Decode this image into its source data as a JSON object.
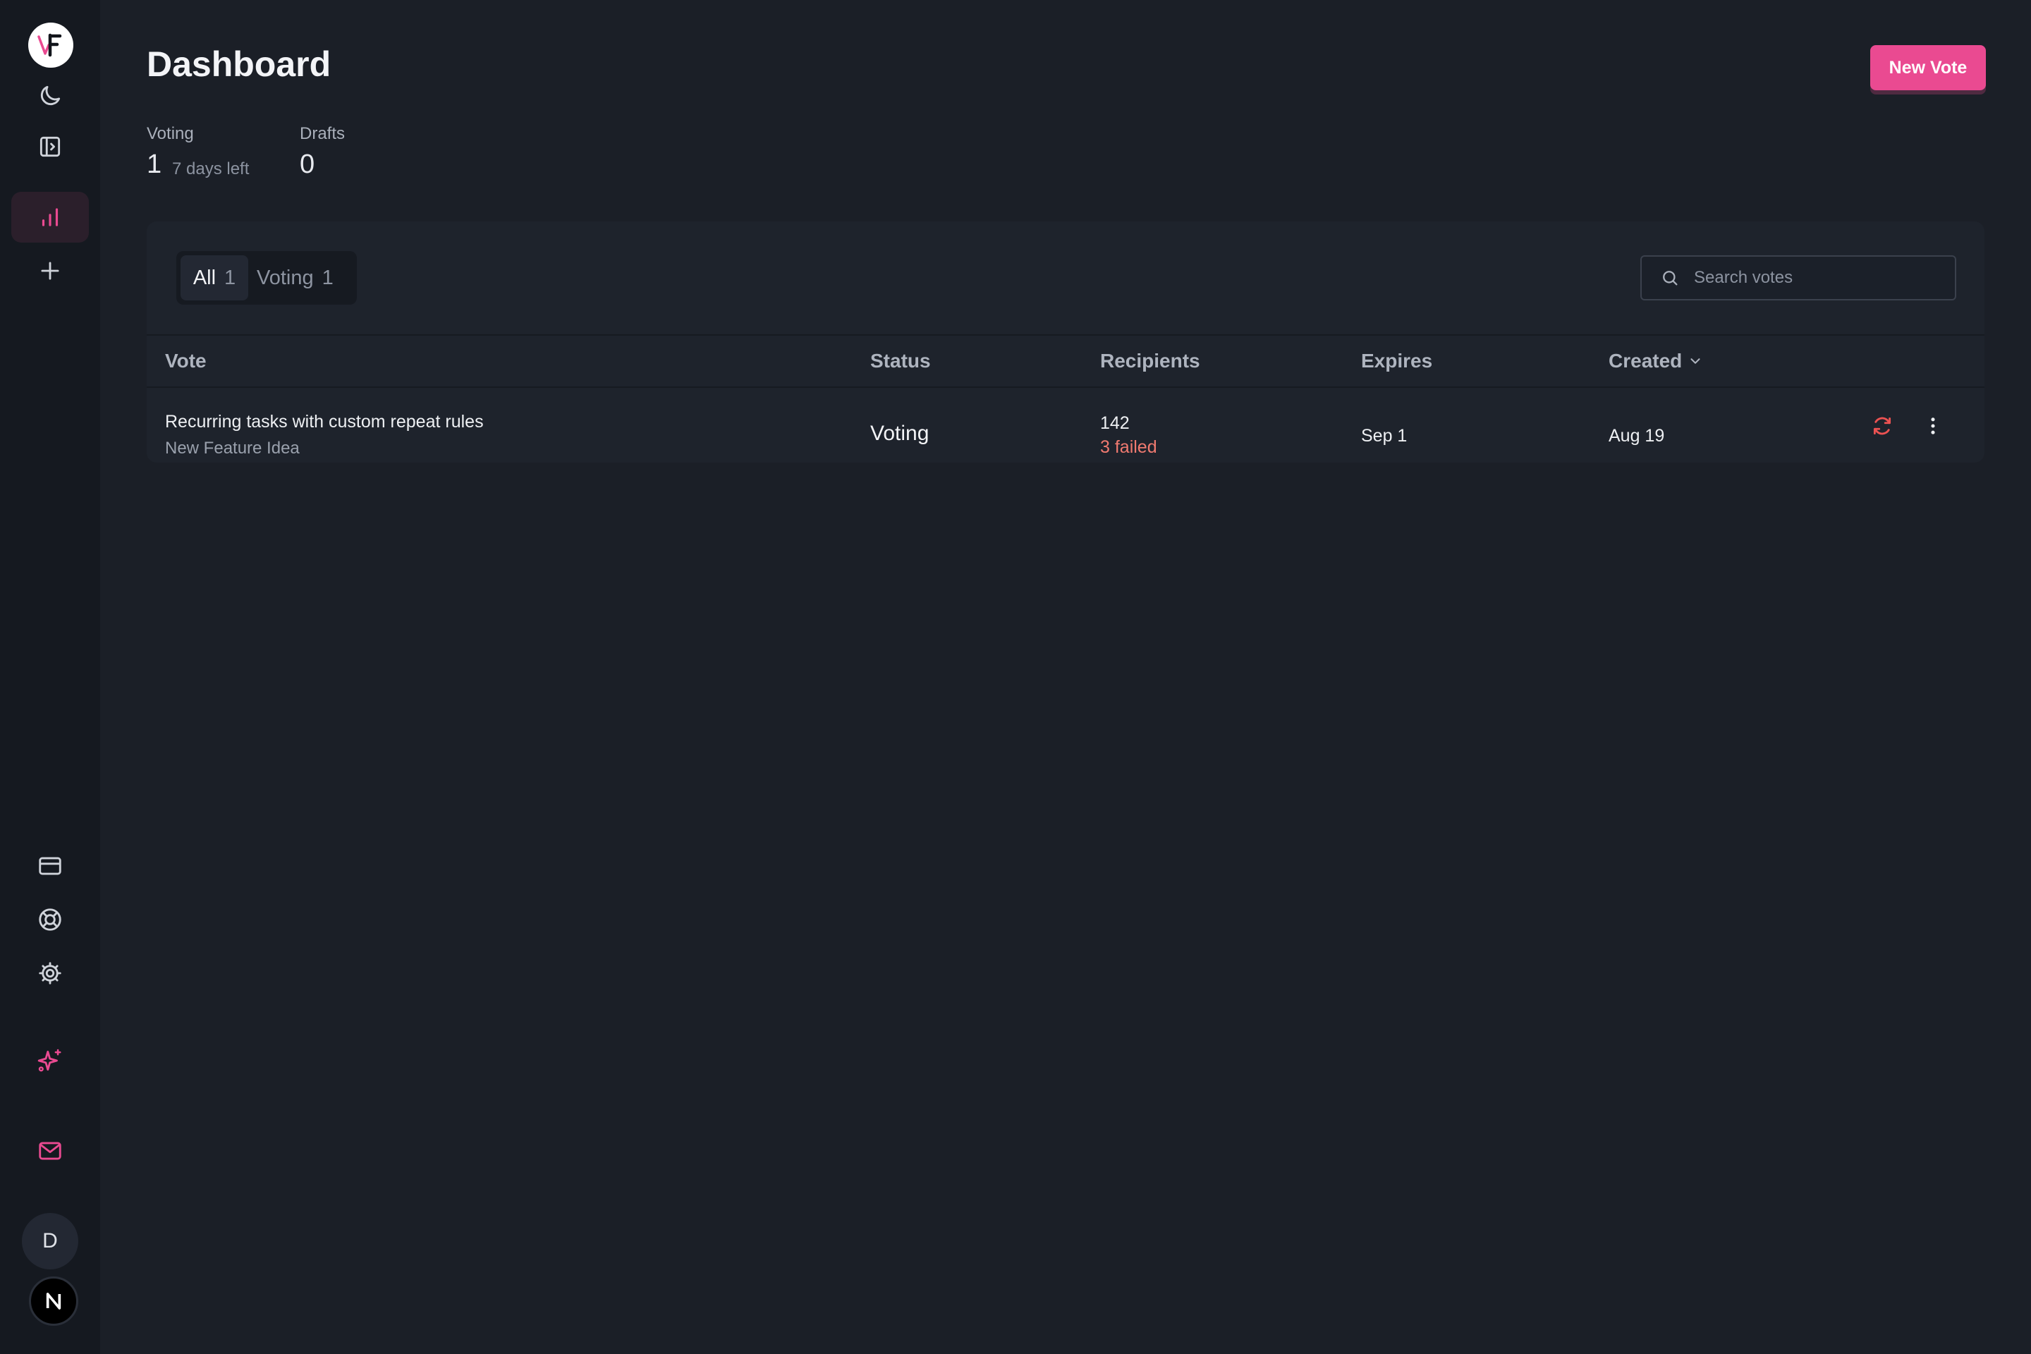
{
  "app": {
    "logo_icon": "vf-logo-icon",
    "accent": "#ea4a91"
  },
  "sidebar": {
    "top_items": [
      {
        "icon": "moon-icon"
      },
      {
        "icon": "sidebar-toggle-icon"
      },
      {
        "icon": "bar-chart-icon",
        "active": true
      },
      {
        "icon": "plus-icon"
      }
    ],
    "bottom_items": [
      {
        "icon": "credit-card-icon"
      },
      {
        "icon": "lifebuoy-icon"
      },
      {
        "icon": "gear-icon"
      },
      {
        "icon": "sparkles-icon"
      },
      {
        "icon": "mail-icon"
      }
    ],
    "avatar_initial": "D",
    "bottom_logo_icon": "n-logo-icon"
  },
  "header": {
    "title": "Dashboard",
    "new_vote_label": "New Vote"
  },
  "stats": {
    "voting_label": "Voting",
    "voting_value": "1",
    "voting_sub": "7 days left",
    "drafts_label": "Drafts",
    "drafts_value": "0"
  },
  "tabs": [
    {
      "label": "All",
      "count": "1",
      "active": true
    },
    {
      "label": "Voting",
      "count": "1",
      "active": false
    }
  ],
  "search": {
    "placeholder": "Search votes",
    "value": ""
  },
  "table": {
    "columns": [
      "Vote",
      "Status",
      "Recipients",
      "Expires",
      "Created"
    ],
    "sorted_column": "Created",
    "rows": [
      {
        "title": "Recurring tasks with custom repeat rules",
        "category": "New Feature Idea",
        "status": "Voting",
        "recipients": "142",
        "failed": "3 failed",
        "expires": "Sep 1",
        "created": "Aug 19",
        "actions": [
          "refresh-icon",
          "more-vertical-icon"
        ]
      }
    ]
  },
  "colors": {
    "background": "#1b1f27",
    "sidebar": "#151920",
    "panel": "#1e232c",
    "failed": "#f07a70"
  }
}
